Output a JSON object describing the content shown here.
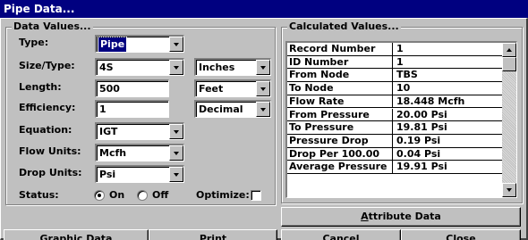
{
  "window": {
    "title": "Pipe Data..."
  },
  "data_values": {
    "legend": "Data Values...",
    "type": {
      "label": "Type:",
      "value": "Pipe"
    },
    "size_type": {
      "label": "Size/Type:",
      "value": "4S",
      "unit": "Inches"
    },
    "length": {
      "label": "Length:",
      "value": "500",
      "unit": "Feet"
    },
    "efficiency": {
      "label": "Efficiency:",
      "value": "1",
      "unit": "Decimal"
    },
    "equation": {
      "label": "Equation:",
      "value": "IGT"
    },
    "flow_units": {
      "label": "Flow Units:",
      "value": "Mcfh"
    },
    "drop_units": {
      "label": "Drop Units:",
      "value": "Psi"
    },
    "status": {
      "label": "Status:",
      "on_label": "On",
      "off_label": "Off",
      "selected": "On"
    },
    "optimize": {
      "label": "Optimize:",
      "checked": false
    }
  },
  "calculated_values": {
    "legend": "Calculated Values...",
    "rows": [
      {
        "name": "Record Number",
        "value": "1"
      },
      {
        "name": "ID Number",
        "value": "1"
      },
      {
        "name": "From Node",
        "value": "TBS"
      },
      {
        "name": "To Node",
        "value": "10"
      },
      {
        "name": "Flow Rate",
        "value": "18.448 Mcfh"
      },
      {
        "name": "From Pressure",
        "value": "20.00 Psi"
      },
      {
        "name": "To Pressure",
        "value": "19.81 Psi"
      },
      {
        "name": "Pressure Drop",
        "value": "0.19 Psi"
      },
      {
        "name": "Drop Per 100.00",
        "value": "0.04 Psi"
      },
      {
        "name": "Average Pressure",
        "value": "19.91 Psi"
      }
    ]
  },
  "buttons": {
    "attribute_data": {
      "mnemonic": "A",
      "rest": "ttribute Data"
    },
    "graphic_data": {
      "mnemonic": "G",
      "rest": "raphic Data"
    },
    "print": {
      "mnemonic": "P",
      "rest": "rint"
    },
    "cancel": {
      "pre": "Ca",
      "mnemonic": "n",
      "rest": "cel"
    },
    "close": {
      "mnemonic": "C",
      "rest": "lose"
    }
  }
}
